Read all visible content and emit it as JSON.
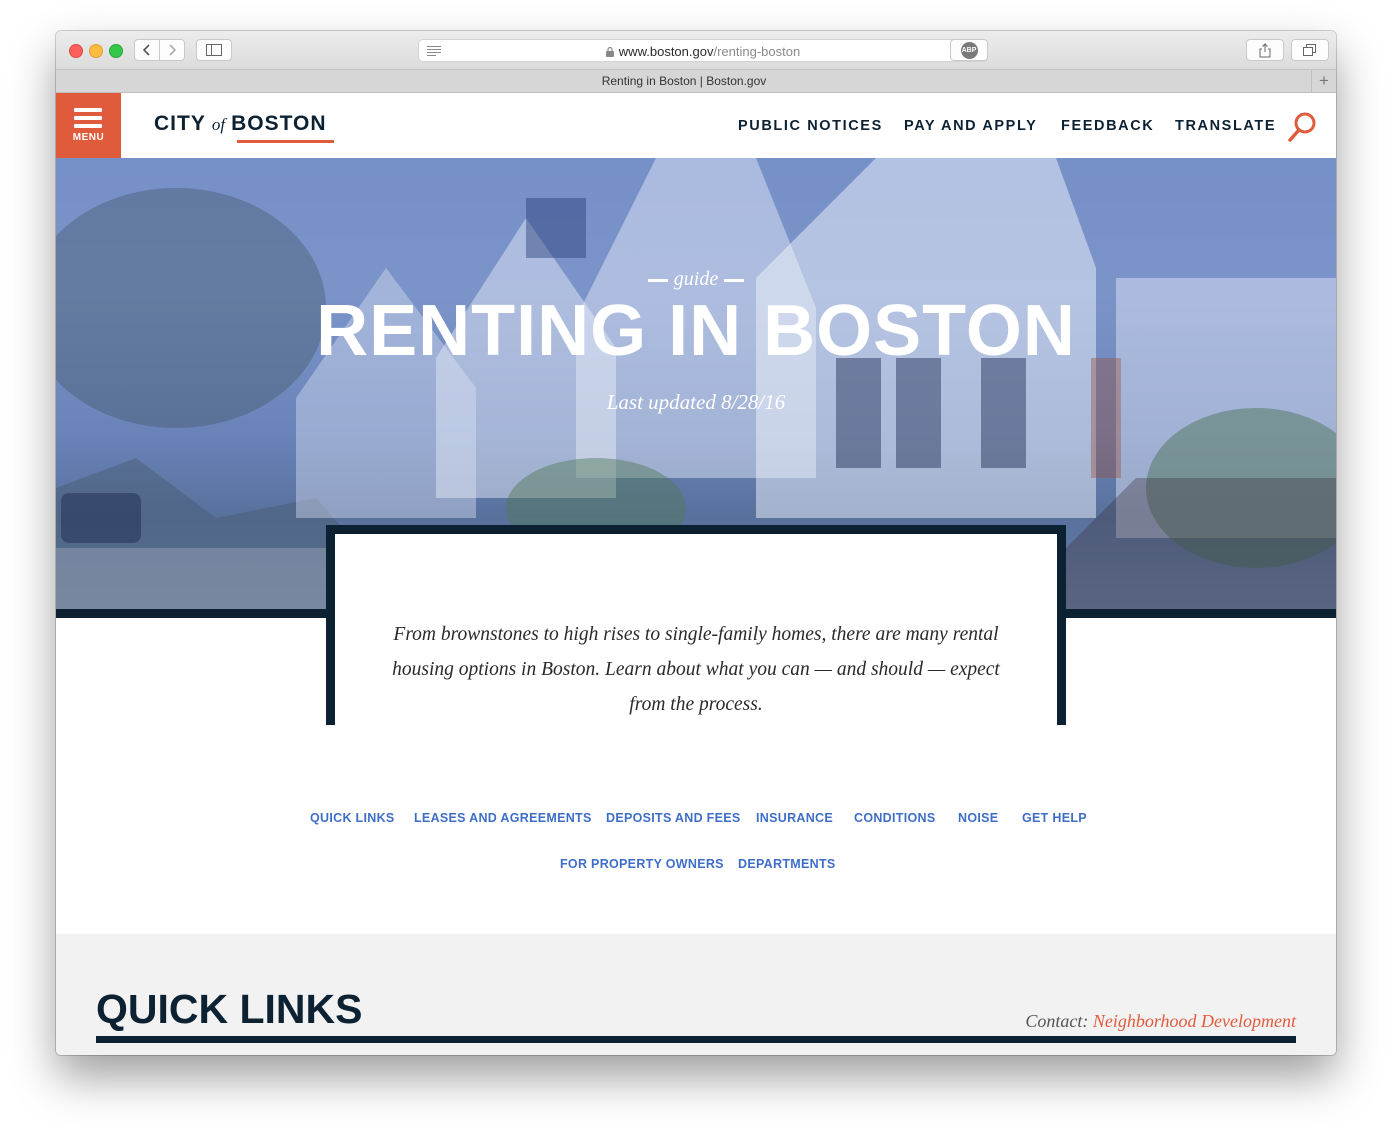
{
  "browser": {
    "url_domain": "www.boston.gov",
    "url_path": "/renting-boston",
    "tab_title": "Renting in Boston | Boston.gov",
    "new_tab_label": "+",
    "adblock_label": "ABP"
  },
  "header": {
    "menu_label": "MENU",
    "logo_city": "CITY",
    "logo_of": "of",
    "logo_boston": "BOSTON",
    "nav": [
      "PUBLIC NOTICES",
      "PAY AND APPLY",
      "FEEDBACK",
      "TRANSLATE"
    ]
  },
  "hero": {
    "eyebrow": "guide",
    "title": "RENTING IN BOSTON",
    "updated": "Last updated 8/28/16"
  },
  "intro": {
    "text": "From brownstones to high rises to single-family homes, there are many rental housing options in Boston. Learn about what you can — and should — expect from the process."
  },
  "sections": [
    "QUICK LINKS",
    "LEASES AND AGREEMENTS",
    "DEPOSITS AND FEES",
    "INSURANCE",
    "CONDITIONS",
    "NOISE",
    "GET HELP",
    "FOR PROPERTY OWNERS",
    "DEPARTMENTS"
  ],
  "quick_links": {
    "title": "QUICK LINKS",
    "contact_label": "Contact:",
    "contact_link": "Neighborhood Development"
  },
  "colors": {
    "brand_red": "#e05b3c",
    "navy": "#0c2132",
    "link_blue": "#3f6ec8"
  }
}
